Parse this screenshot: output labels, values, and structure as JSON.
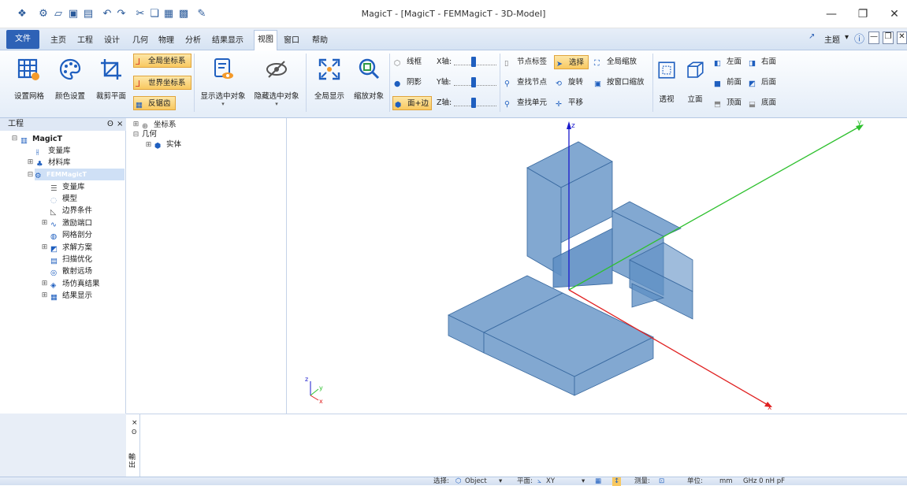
{
  "window": {
    "title": "MagicT - [MagicT - FEMMagicT - 3D-Model]",
    "minimize": "—",
    "restore": "❐",
    "close": "✕"
  },
  "menu": {
    "file": "文件",
    "items": [
      "主页",
      "工程",
      "设计",
      "几何",
      "物理",
      "分析",
      "结果显示",
      "视图",
      "窗口",
      "帮助"
    ],
    "active": "视图",
    "theme_label": "主题",
    "theme_arrow": "▾",
    "info_icon": "ⓘ",
    "min_icon": "—",
    "restore_icon": "❐",
    "close_icon": "✕"
  },
  "ribbon": {
    "set_mesh": "设置网格",
    "color_settings": "颜色设置",
    "clip_plane": "裁剪平面",
    "global_coord": "全局坐标系",
    "world_coord": "世界坐标系",
    "antialias": "反锯齿",
    "show_selected": "显示选中对象",
    "hide_selected": "隐藏选中对象",
    "fit_all": "全局显示",
    "zoom_object": "缩放对象",
    "wireframe": "线框",
    "shadow": "阴影",
    "face_edge": "面+边",
    "x_axis": "X轴:",
    "y_axis": "Y轴:",
    "z_axis": "Z轴:",
    "node_label": "节点标签",
    "find_node": "查找节点",
    "find_element": "查找单元",
    "select": "选择",
    "rotate": "旋转",
    "pan": "平移",
    "global_zoom": "全局缩放",
    "window_zoom": "按窗口缩放",
    "perspective": "透视",
    "elevation": "立面",
    "left_view": "左面",
    "right_view": "右面",
    "front_view": "前面",
    "back_view": "后面",
    "top_view": "顶面",
    "bottom_view": "底面"
  },
  "tree": {
    "header": "工程",
    "pin": "ʘ",
    "close": "×",
    "root": "MagicT",
    "variables": "变量库",
    "materials": "材料库",
    "project": "FEMMagicT",
    "children": [
      "变量库",
      "模型",
      "边界条件",
      "激励端口",
      "网格剖分",
      "求解方案",
      "扫描优化",
      "散射远场",
      "场仿真结果",
      "结果显示"
    ]
  },
  "geo_tree": {
    "coord": "坐标系",
    "geometry": "几何",
    "solid": "实体"
  },
  "viewport": {
    "axis_x": "x",
    "axis_y": "y",
    "axis_z": "z",
    "triad_x": "x",
    "triad_y": "y",
    "triad_z": "z",
    "colors": {
      "x_axis": "#e02020",
      "y_axis": "#2ec02e",
      "z_axis": "#1a1acc",
      "solid_face": "#5f8fc4",
      "solid_edge": "#3a6aa0"
    }
  },
  "bottom_panel": {
    "close": "×",
    "pin": "ʘ",
    "side_label": "輸出"
  },
  "status": {
    "select_label": "选择:",
    "select_value": "Object",
    "plane_label": "平面:",
    "plane_value": "XY",
    "measure_label": "测量:",
    "unit_label": "单位:",
    "unit_value": "mm",
    "freq_value": "GHz 0 nH pF"
  }
}
